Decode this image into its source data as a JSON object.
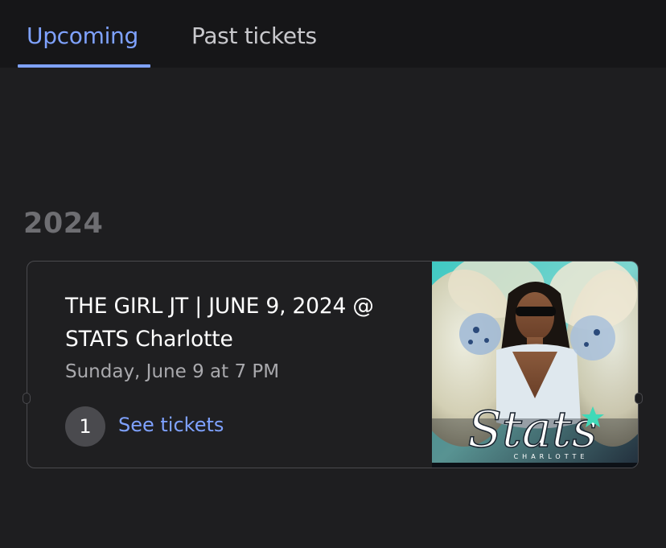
{
  "tabs": {
    "upcoming_label": "Upcoming",
    "past_label": "Past tickets",
    "active": "Upcoming"
  },
  "section": {
    "year": "2024"
  },
  "ticket": {
    "title": "THE GIRL JT |  JUNE  9, 2024 @ STATS Charlotte",
    "date": "Sunday, June 9 at 7 PM",
    "quantity": "1",
    "see_tickets_label": "See tickets",
    "image": {
      "logo_text": "Stats",
      "sub_text": "CHARLOTTE"
    }
  },
  "colors": {
    "background": "#1e1e20",
    "tabbar": "#161618",
    "accent": "#7fa2ff",
    "card_border": "#4a4a4e",
    "muted_text": "#a9a9ad",
    "year_text": "#6e6e72"
  }
}
